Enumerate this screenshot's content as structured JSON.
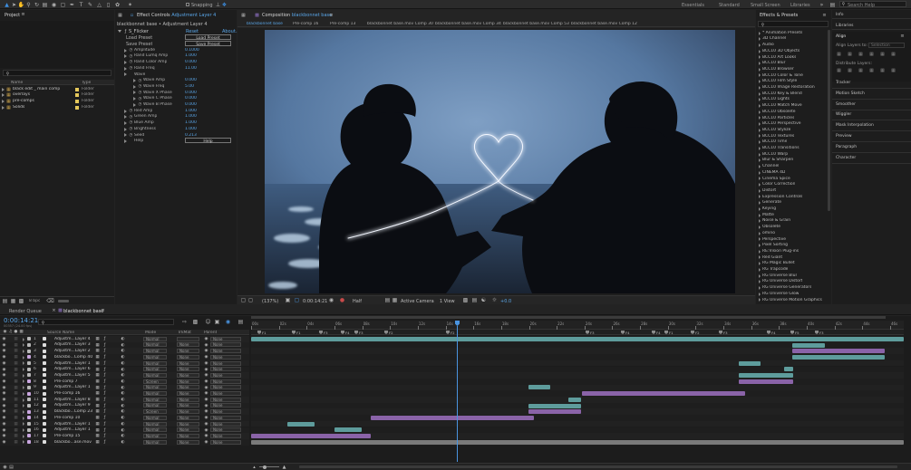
{
  "toolbar": {
    "snapping": "Snapping",
    "workspaces": [
      "Essentials",
      "Standard",
      "Small Screen",
      "Libraries"
    ],
    "search_placeholder": "Search Help"
  },
  "project": {
    "title": "Project",
    "cols": [
      "Name",
      "Type"
    ],
    "items": [
      {
        "name": "black edit _ main comp",
        "type": "Folder",
        "color": "#e5c85a"
      },
      {
        "name": "overlays",
        "type": "Folder",
        "color": "#e5c85a"
      },
      {
        "name": "pre-comps",
        "type": "Folder",
        "color": "#e5c85a"
      },
      {
        "name": "Solids",
        "type": "Folder",
        "color": "#e5c85a"
      }
    ],
    "bpc": "8 bpc"
  },
  "effect_controls": {
    "tab": "Effect Controls",
    "layer": "Adjustment Layer 4",
    "subtitle": "blackbonnet base • Adjustment Layer 4",
    "effect": "S_Flicker",
    "reset": "Reset",
    "about": "About...",
    "load_preset": "Load Preset",
    "save_preset": "Save Preset",
    "params": [
      {
        "label": "Amplitude",
        "value": "0.1000",
        "indent": 1
      },
      {
        "label": "Rand Lumq Amp",
        "value": "1.000",
        "indent": 1
      },
      {
        "label": "Rand Color Amp",
        "value": "0.000",
        "indent": 1
      },
      {
        "label": "Rand Freq",
        "value": "11.00",
        "indent": 1
      },
      {
        "label": "Wave",
        "value": "",
        "indent": 1
      },
      {
        "label": "Wave Amp",
        "value": "0.000",
        "indent": 2
      },
      {
        "label": "Wave Freq",
        "value": "5.00",
        "indent": 2
      },
      {
        "label": "Wave X Phase",
        "value": "0.000",
        "indent": 2
      },
      {
        "label": "Wave C Phase",
        "value": "0.000",
        "indent": 2
      },
      {
        "label": "Wave B Phase",
        "value": "0.000",
        "indent": 2
      },
      {
        "label": "Red Amp",
        "value": "1.000",
        "indent": 1
      },
      {
        "label": "Green Amp",
        "value": "1.000",
        "indent": 1
      },
      {
        "label": "Blue Amp",
        "value": "1.000",
        "indent": 1
      },
      {
        "label": "Brightness",
        "value": "1.000",
        "indent": 1
      },
      {
        "label": "Seed",
        "value": "0.213",
        "indent": 1
      },
      {
        "label": "Help",
        "value": "",
        "indent": 1
      }
    ],
    "help_button": "Help"
  },
  "composition": {
    "tab": "Composition",
    "comp_name": "blackbonnet base",
    "tabs": [
      "blackbonnet base",
      "Pre-comp 16",
      "Pre-comp 13",
      "blackbonnet base.mov Comp 30",
      "blackbonnet base.mov Comp 34",
      "blackbonnet base.mov Comp 53",
      "blackbonnet base.mov Comp 12"
    ],
    "footer": {
      "zoom": "(137%)",
      "timecode": "0:00:14:21",
      "resolution": "Half",
      "camera": "Active Camera",
      "view": "1 View",
      "exposure": "+0.0"
    }
  },
  "effects_presets": {
    "title": "Effects & Presets",
    "items": [
      "* Animation Presets",
      "3D Channel",
      "Audio",
      "BCC10 3D Objects",
      "BCC10 Art Looks",
      "BCC10 Blur",
      "BCC10 Browser",
      "BCC10 Color & Tone",
      "BCC10 Film Style",
      "BCC10 Image Restoration",
      "BCC10 Key & Blend",
      "BCC10 Lights",
      "BCC10 Match Move",
      "BCC10 Obsolete",
      "BCC10 Particles",
      "BCC10 Perspective",
      "BCC10 Stylize",
      "BCC10 Textures",
      "BCC10 Time",
      "BCC10 Transitions",
      "BCC10 Warp",
      "Blur & Sharpen",
      "Channel",
      "CINEMA 4D",
      "Cinema Spice",
      "Color Correction",
      "Distort",
      "Expression Controls",
      "Generate",
      "Keying",
      "Matte",
      "Noise & Grain",
      "Obsolete",
      "omino",
      "Perspective",
      "Pixel Sorting",
      "RE:Vision Plug-ins",
      "Red Giant",
      "RG Magic Bullet",
      "RG Trapcode",
      "RG Universe Blur",
      "RG Universe Distort",
      "RG Universe Generators",
      "RG Universe Glow",
      "RG Universe Motion Graphics",
      "RG Universe Noise"
    ]
  },
  "right_panels": {
    "info": "Info",
    "libraries": "Libraries",
    "align": "Align",
    "align_layers_to": "Align Layers to:",
    "align_target": "Selection",
    "distribute": "Distribute Layers:",
    "others": [
      "Tracker",
      "Motion Sketch",
      "Smoother",
      "Wiggler",
      "Mask Interpolation",
      "Preview",
      "Paragraph",
      "Character"
    ]
  },
  "timeline": {
    "render_queue": "Render Queue",
    "comp_tab": "blackbonnet base",
    "timecode": "0:00:14:21",
    "frame_info": "00357 (24.00 fps)",
    "col_source": "Source Name",
    "col_mode": "Mode",
    "col_trkmat": "TrkMat",
    "col_parent": "Parent",
    "ruler": [
      "00s",
      "02s",
      "04s",
      "06s",
      "08s",
      "10s",
      "12s",
      "14s",
      "16s",
      "18s",
      "20s",
      "22s",
      "24s",
      "26s",
      "28s",
      "30s",
      "32s",
      "34s",
      "36s",
      "38s",
      "40s",
      "42s",
      "44s",
      "46s"
    ],
    "layers": [
      {
        "num": "1",
        "name": "Adjustm...Layer 4",
        "color": "#b9b9b9",
        "mode": "Normal",
        "trk": "",
        "parent": "None"
      },
      {
        "num": "2",
        "name": "Adjustm...Layer 3",
        "color": "#b9b9b9",
        "mode": "Normal",
        "trk": "None",
        "parent": "None"
      },
      {
        "num": "3",
        "name": "Adjustm...Layer 2",
        "color": "#b9b9b9",
        "mode": "Normal",
        "trk": "None",
        "parent": "None"
      },
      {
        "num": "4",
        "name": "blackbo...Comp 40",
        "color": "#c9a6e0",
        "mode": "Normal",
        "trk": "None",
        "parent": "None"
      },
      {
        "num": "5",
        "name": "Adjustm...Layer 1",
        "color": "#b9b9b9",
        "mode": "Normal",
        "trk": "None",
        "parent": "None"
      },
      {
        "num": "6",
        "name": "Adjustm...Layer 6",
        "color": "#b9b9b9",
        "mode": "Normal",
        "trk": "None",
        "parent": "None"
      },
      {
        "num": "7",
        "name": "Adjustm...Layer 5",
        "color": "#b9b9b9",
        "mode": "Normal",
        "trk": "None",
        "parent": "None"
      },
      {
        "num": "8",
        "name": "Pre-comp 7",
        "color": "#c9a6e0",
        "mode": "Screen",
        "trk": "None",
        "parent": "None"
      },
      {
        "num": "9",
        "name": "Adjustm...Layer 1",
        "color": "#b9b9b9",
        "mode": "Normal",
        "trk": "None",
        "parent": "None"
      },
      {
        "num": "10",
        "name": "Pre-comp 16",
        "color": "#c9a6e0",
        "mode": "Normal",
        "trk": "None",
        "parent": "None"
      },
      {
        "num": "11",
        "name": "Adjustm...Layer 8",
        "color": "#b9b9b9",
        "mode": "Normal",
        "trk": "None",
        "parent": "None"
      },
      {
        "num": "12",
        "name": "Adjustm...Layer 9",
        "color": "#b9b9b9",
        "mode": "Normal",
        "trk": "None",
        "parent": "None"
      },
      {
        "num": "13",
        "name": "blackbo...Comp 23",
        "color": "#c9a6e0",
        "mode": "Screen",
        "trk": "None",
        "parent": "None"
      },
      {
        "num": "14",
        "name": "Pre-comp 10",
        "color": "#c9a6e0",
        "mode": "Normal",
        "trk": "None",
        "parent": "None"
      },
      {
        "num": "15",
        "name": "Adjustm...Layer 1",
        "color": "#b9b9b9",
        "mode": "Normal",
        "trk": "None",
        "parent": "None"
      },
      {
        "num": "16",
        "name": "Adjustm...Layer 1",
        "color": "#b9b9b9",
        "mode": "Normal",
        "trk": "None",
        "parent": "None"
      },
      {
        "num": "17",
        "name": "Pre-comp 15",
        "color": "#c9a6e0",
        "mode": "Normal",
        "trk": "None",
        "parent": "None"
      },
      {
        "num": "18",
        "name": "blackbo...ase.mov",
        "color": "#c9a6e0",
        "mode": "Normal",
        "trk": "None",
        "parent": "None"
      }
    ],
    "markers": [
      "F1",
      "F1",
      "F3",
      "F4",
      "F3",
      "F2",
      "F2",
      "F3",
      "F4",
      "F4",
      "F1",
      "F2",
      "F3",
      "F4",
      "F5",
      "F3"
    ]
  }
}
